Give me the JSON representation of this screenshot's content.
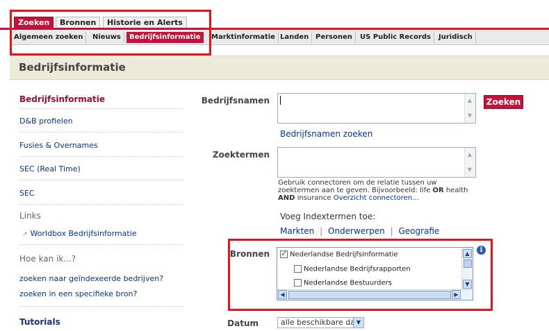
{
  "top_tabs": [
    "Zoeken",
    "Bronnen",
    "Historie en Alerts"
  ],
  "sub_tabs": [
    "Algemeen zoeken",
    "Nieuws",
    "Bedrijfsinformatie",
    "Marktinformatie",
    "Landen",
    "Personen",
    "US Public Records",
    "Juridisch"
  ],
  "page_title": "Bedrijfsinformatie",
  "sidebar": {
    "items": [
      "Bedrijfsinformatie",
      "D&B profielen",
      "Fusies & Overnames",
      "SEC (Real Time)",
      "SEC"
    ],
    "links_heading": "Links",
    "links": [
      "Worldbox Bedrijfsinformatie"
    ],
    "help_heading": "Hoe kan ik...?",
    "help_links": [
      "zoeken naar geïndexeerde bedrijven?",
      "zoeken in een specifieke bron?"
    ],
    "tutorials": "Tutorials"
  },
  "form": {
    "company_label": "Bedrijfsnamen",
    "company_value": "",
    "search_button": "Zoeken",
    "company_link": "Bedrijfsnamen zoeken",
    "terms_label": "Zoektermen",
    "terms_value": "",
    "help_text_1": "Gebruik connectoren om de relatie tussen uw zoektermen aan te geven. Bijvoorbeeld: life",
    "help_or": "OR",
    "help_text_2": "health",
    "help_and": "AND",
    "help_text_3": "insurance",
    "help_link": "Overzicht connectoren...",
    "index_label": "Voeg Indextermen toe:",
    "index_links": [
      "Markten",
      "Onderwerpen",
      "Geografie"
    ],
    "sources_label": "Bronnen",
    "sources": [
      {
        "label": "Nederlandse Bedrijfsinformatie",
        "checked": true
      },
      {
        "label": "Nederlandse Bedrijfsrapporten",
        "checked": false
      },
      {
        "label": "Nederlandse Bestuurders",
        "checked": false
      }
    ],
    "date_label": "Datum",
    "date_value": "alle beschikbare data"
  },
  "colors": {
    "accent": "#c4123a",
    "link": "#003399",
    "highlight": "#e3131f"
  }
}
